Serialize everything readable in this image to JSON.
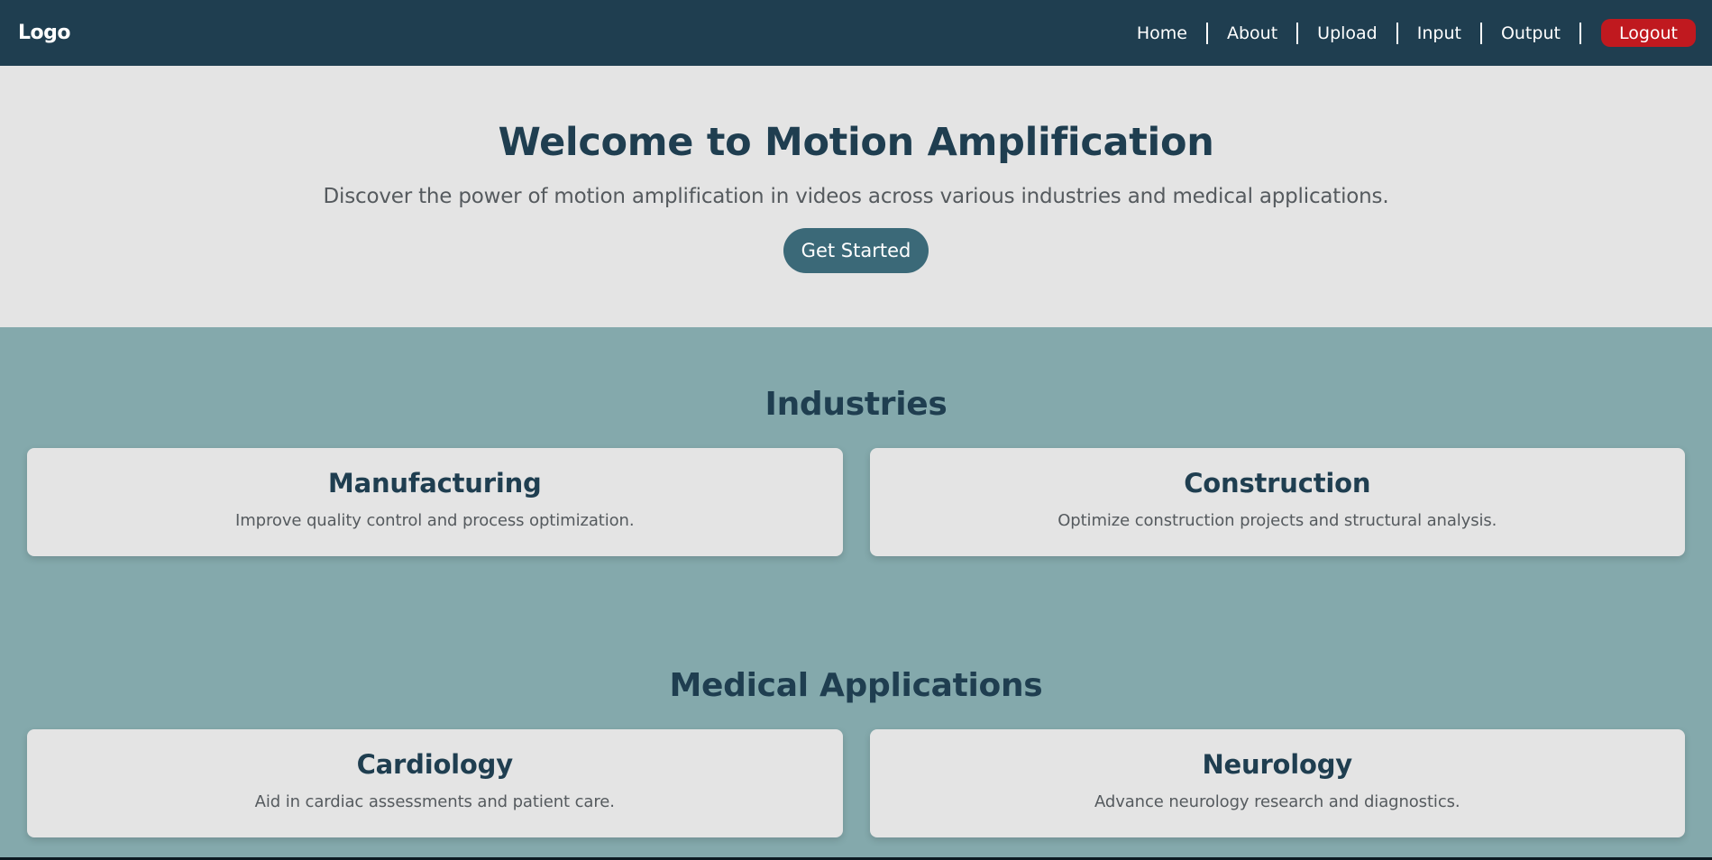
{
  "navbar": {
    "logo": "Logo",
    "links": [
      "Home",
      "About",
      "Upload",
      "Input",
      "Output"
    ],
    "logout": "Logout"
  },
  "hero": {
    "title": "Welcome to Motion Amplification",
    "subtitle": "Discover the power of motion amplification in videos across various industries and medical applications.",
    "cta": "Get Started"
  },
  "industries": {
    "title": "Industries",
    "cards": [
      {
        "title": "Manufacturing",
        "desc": "Improve quality control and process optimization."
      },
      {
        "title": "Construction",
        "desc": "Optimize construction projects and structural analysis."
      }
    ]
  },
  "medical": {
    "title": "Medical Applications",
    "cards": [
      {
        "title": "Cardiology",
        "desc": "Aid in cardiac assessments and patient care."
      },
      {
        "title": "Neurology",
        "desc": "Advance neurology research and diagnostics."
      }
    ]
  },
  "colors": {
    "navbar_bg": "#1f3e50",
    "hero_bg": "#e4e4e4",
    "section_bg": "#84a9ac",
    "cta_bg": "#3b6978",
    "logout_bg": "#c0191f",
    "heading": "#1f3e50"
  }
}
